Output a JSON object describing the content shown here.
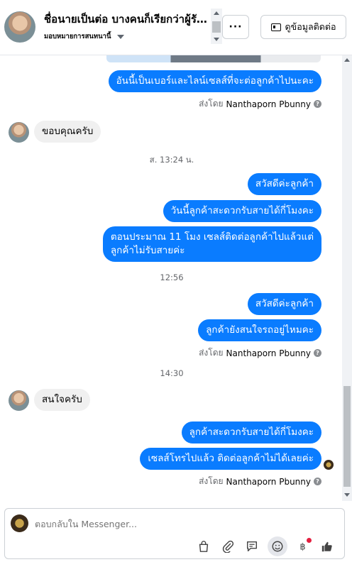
{
  "header": {
    "title": "ชื่อนายเป็นต่อ บางคนก็เรียกว่าผู้รับ...",
    "assignee": "มอบหมายการสนทนานี้",
    "more_label": "···",
    "contact_label": "ดูข้อมูลติดต่อ"
  },
  "messages": {
    "m1": "อันนี้เป็นเบอร์และไลน์เซลส์ที่จะต่อลูกค้าไปนะคะ",
    "sent1_prefix": "ส่งโดย",
    "sent1_name": "Nanthaporn Pbunny",
    "in1": "ขอบคุณครับ",
    "ts1": "ส. 13:24 น.",
    "m2": "สวัสดีค่ะลูกค้า",
    "m3": "วันนี้ลูกค้าสะดวกรับสายได้กี่โมงคะ",
    "m4_line1": "ตอนประมาณ 11 โมง เซลส์ติดต่อลูกค้าไปแล้วแต่",
    "m4_line2": "ลูกค้าไม่รับสายค่ะ",
    "ts2": "12:56",
    "m5": "สวัสดีค่ะลูกค้า",
    "m6": "ลูกค้ายังสนใจรถอยู่ไหมคะ",
    "sent2_prefix": "ส่งโดย",
    "sent2_name": "Nanthaporn Pbunny",
    "ts3": "14:30",
    "in2": "สนใจครับ",
    "m7": "ลูกค้าสะดวกรับสายได้กี่โมงคะ",
    "m8": "เซลส์โทรไปแล้ว ติดต่อลูกค้าไม่ได้เลยค่ะ",
    "sent3_prefix": "ส่งโดย",
    "sent3_name": "Nanthaporn Pbunny",
    "help_glyph": "?"
  },
  "composer": {
    "placeholder": "ตอบกลับใน Messenger..."
  },
  "colors": {
    "outgoing_bubble": "#0a7cff",
    "incoming_bubble": "#f0f0f0",
    "notification_dot": "#e41e3f"
  },
  "icons": [
    "chevron-down-icon",
    "more-icon",
    "contact-card-icon",
    "help-icon",
    "shopping-bag-icon",
    "attachment-icon",
    "saved-reply-icon",
    "emoji-icon",
    "baht-icon",
    "like-icon"
  ]
}
